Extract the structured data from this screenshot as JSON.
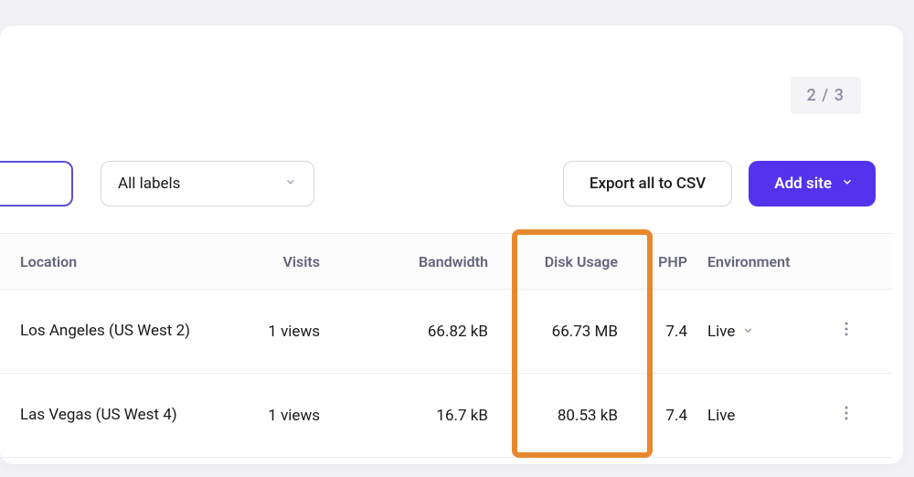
{
  "pagination": "2 / 3",
  "toolbar": {
    "labels_dropdown": "All labels",
    "export_label": "Export all to CSV",
    "add_label": "Add site"
  },
  "table": {
    "headers": {
      "location": "Location",
      "visits": "Visits",
      "bandwidth": "Bandwidth",
      "disk": "Disk Usage",
      "php": "PHP",
      "env": "Environment"
    },
    "rows": [
      {
        "location": "Los Angeles (US West 2)",
        "visits": "1 views",
        "bandwidth": "66.82 kB",
        "disk": "66.73 MB",
        "php": "7.4",
        "env": "Live",
        "env_has_chevron": true
      },
      {
        "location": "Las Vegas (US West 4)",
        "visits": "1 views",
        "bandwidth": "16.7 kB",
        "disk": "80.53 kB",
        "php": "7.4",
        "env": "Live",
        "env_has_chevron": false
      }
    ]
  }
}
